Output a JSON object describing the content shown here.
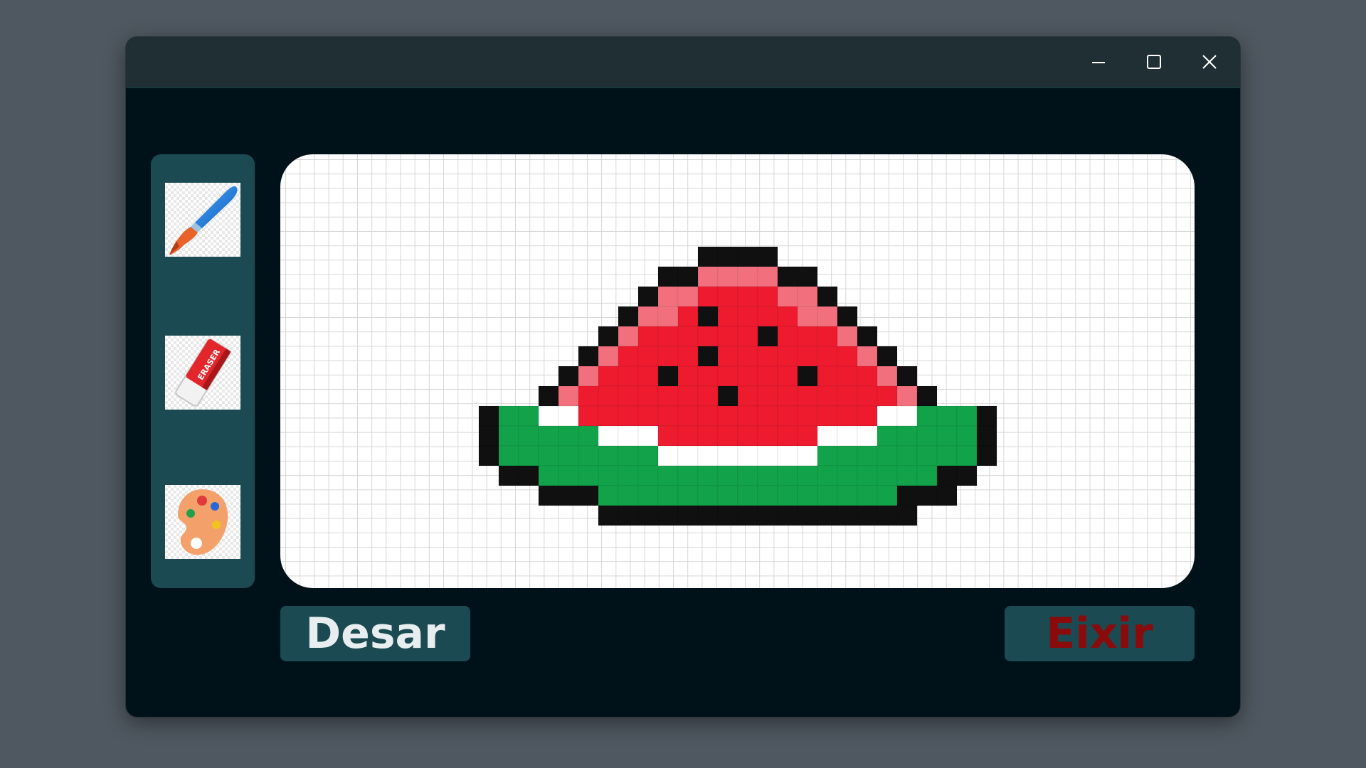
{
  "window": {
    "controls": {
      "minimize_icon": "minimize-icon",
      "maximize_icon": "maximize-icon",
      "close_icon": "close-icon"
    },
    "colors": {
      "background": "#001219",
      "titlebar": "#1f2f33",
      "panel": "#1b4a52"
    }
  },
  "toolbar": {
    "tools": [
      {
        "icon": "paintbrush-icon"
      },
      {
        "icon": "eraser-icon",
        "label": "ERASER"
      },
      {
        "icon": "palette-icon"
      }
    ]
  },
  "canvas": {
    "palette": {
      "K": "#101010",
      "P": "#f2707e",
      "R": "#ee1b2f",
      "W": "#ffffff",
      "G": "#12a34a",
      "D": "#0c7a36"
    },
    "rows": [
      "...........KKKK...........",
      ".........KKPPPPKK.........",
      "........KPPRRRRPPK........",
      ".......KPPRKRRRRPPK.......",
      "......KPRRRRRRKRRRPK......",
      ".....KPRRRRKRRRRRRRPK.....",
      "....KPRRRKRRRRRRKRRRPK....",
      "...KPRRRRRRRKRRRRRRRRPK...",
      "KGGWWRRRRRRRRRRRRRRRWWGGGK",
      "KGGGGGWWWRRRRRRRRWWWGGGGGK",
      "KGGGGGGGGWWWWWWWWGGGGGGGGK",
      ".KKGGGGGGGGGGGGGGGGGGGGKK.",
      "...KKKGGGGGGGGGGGGGGGKKK..",
      "......KKKKKKKKKKKKKKKK...."
    ]
  },
  "actions": {
    "save_label": "Desar",
    "exit_label": "Eixir"
  }
}
